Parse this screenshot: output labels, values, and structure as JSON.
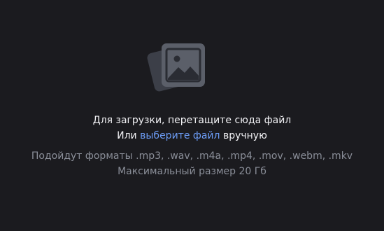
{
  "upload": {
    "icon": "image-placeholder-icon",
    "title": "Для загрузки, перетащите сюда файл",
    "alt_prefix": "Или",
    "choose_link": "выберите файл",
    "alt_suffix": "вручную",
    "formats": "Подойдут форматы .mp3, .wav, .m4a, .mp4, .mov, .webm, .mkv",
    "max_size": "Максимальный размер 20 Гб"
  },
  "colors": {
    "background": "#1b1b1f",
    "text_primary": "#f2f2f5",
    "text_secondary": "#8a8e98",
    "link": "#6c9cf5",
    "icon_front": "#5b5f69",
    "icon_back": "#3c3f48"
  }
}
